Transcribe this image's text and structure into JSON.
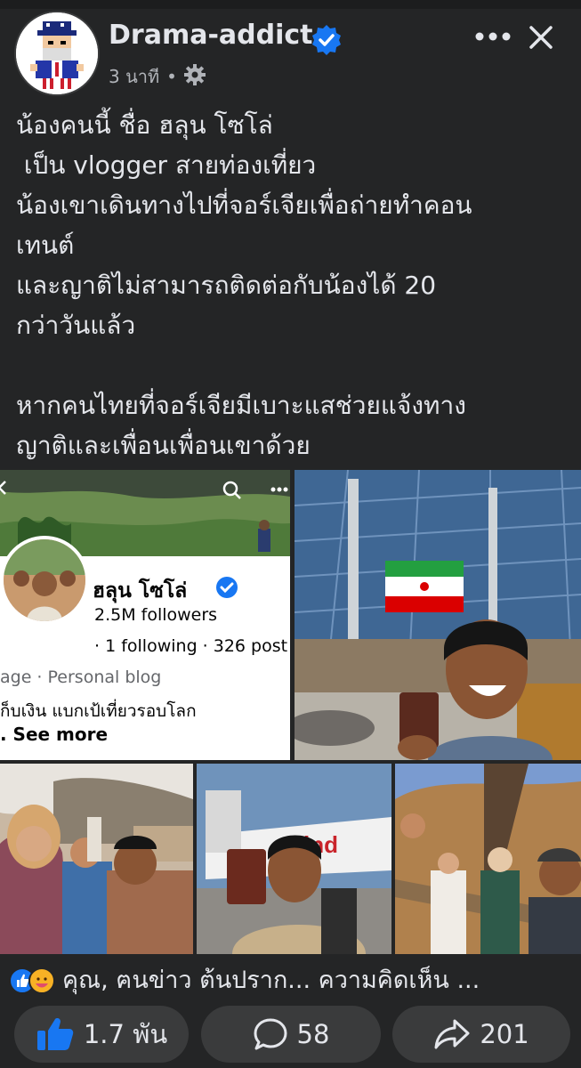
{
  "post": {
    "page_name": "Drama-addict",
    "time": "3 นาที",
    "separator": "•",
    "text": "น้องคนนี้ ชื่อ ฮลุน โซโล่\n เป็น vlogger สายท่องเที่ยว\nน้องเขาเดินทางไปที่จอร์เจียเพื่อถ่ายทำคอน\nเทนต์\nและญาติไม่สามารถติดต่อกับน้องได้ 20\nกว่าวันแล้ว\n\nหากคนไทยที่จอร์เจียมีเบาะแสช่วยแจ้งทาง\nญาติและเพื่อนเพื่อนเขาด้วย"
  },
  "profile_card": {
    "name": "ฮลุน โซโล่",
    "followers": "2.5M followers",
    "following": "· 1 following · 326 post",
    "type": "age · Personal blog",
    "bio": "ก็บเงิน แบกเป้เที่ยวรอบโลก",
    "see_more": ". See more"
  },
  "reactions": {
    "summary": "คุณ, ฅนข่าว ต้นปราก... ความคิดเห็น ..."
  },
  "actions": {
    "likes": "1.7 พัน",
    "comments": "58",
    "shares": "201"
  },
  "icons": {
    "more": "more-horizontal-icon",
    "close": "close-icon",
    "audience": "gear-icon",
    "like": "thumbs-up-icon",
    "comment": "comment-bubble-icon",
    "share": "share-arrow-icon"
  },
  "colors": {
    "background": "#242526",
    "verified": "#1877f2",
    "pill": "#3a3b3c"
  }
}
